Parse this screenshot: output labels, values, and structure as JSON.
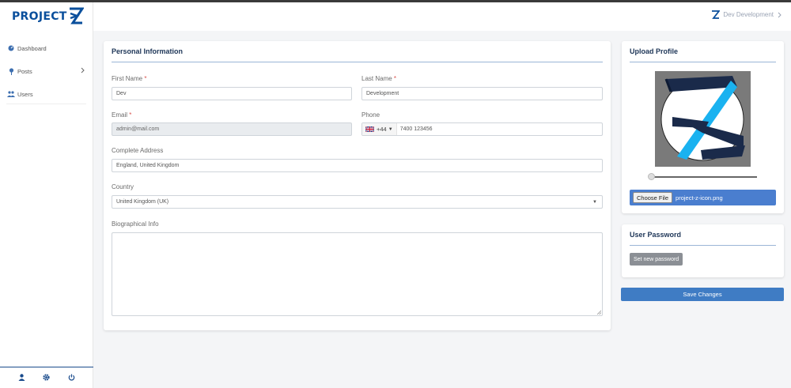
{
  "app": {
    "logo_text": "PROJECT",
    "brand_color": "#0a4f9c"
  },
  "sidebar": {
    "items": [
      {
        "label": "Dashboard",
        "icon": "dashboard-icon"
      },
      {
        "label": "Posts",
        "icon": "pin-icon",
        "has_submenu": true
      },
      {
        "label": "Users",
        "icon": "users-icon"
      }
    ],
    "footer_icons": [
      "user-icon",
      "gear-icon",
      "power-icon"
    ]
  },
  "header": {
    "user_name": "Dev Development"
  },
  "personal": {
    "title": "Personal Information",
    "first_name": {
      "label": "First Name",
      "required_mark": "*",
      "value": "Dev"
    },
    "last_name": {
      "label": "Last Name",
      "required_mark": "*",
      "value": "Development"
    },
    "email": {
      "label": "Email",
      "required_mark": "*",
      "value": "admin@mail.com"
    },
    "phone": {
      "label": "Phone",
      "dial_code": "+44",
      "value": "7400 123456"
    },
    "address": {
      "label": "Complete Address",
      "value": "England, United Kingdom"
    },
    "country": {
      "label": "Country",
      "value": "United Kingdom (UK)"
    },
    "bio": {
      "label": "Biographical Info",
      "value": ""
    }
  },
  "upload": {
    "title": "Upload Profile",
    "choose_label": "Choose File",
    "file_name": "project-z-icon.png"
  },
  "password": {
    "title": "User Password",
    "button_label": "Set new password"
  },
  "actions": {
    "save_label": "Save Changes"
  }
}
